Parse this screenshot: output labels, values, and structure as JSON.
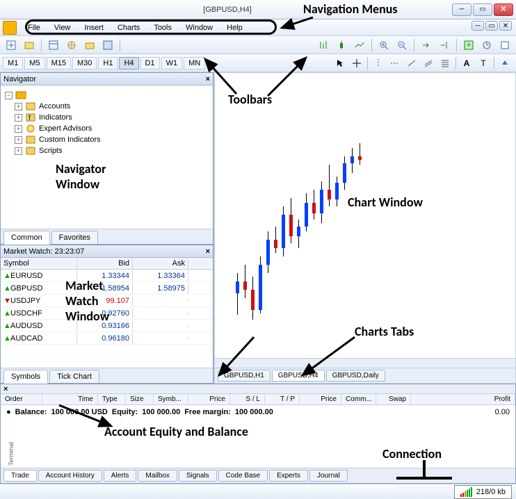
{
  "window": {
    "title": "[GBPUSD,H4]"
  },
  "menu": {
    "items": [
      "File",
      "View",
      "Insert",
      "Charts",
      "Tools",
      "Window",
      "Help"
    ]
  },
  "timeframes": {
    "items": [
      "M1",
      "M5",
      "M15",
      "M30",
      "H1",
      "H4",
      "D1",
      "W1",
      "MN"
    ],
    "active": "H4"
  },
  "navigator": {
    "title": "Navigator",
    "items": [
      "Accounts",
      "Indicators",
      "Expert Advisors",
      "Custom Indicators",
      "Scripts"
    ],
    "tabs": [
      "Common",
      "Favorites"
    ],
    "active_tab": "Common"
  },
  "market_watch": {
    "title": "Market Watch: 23:23:07",
    "columns": [
      "Symbol",
      "Bid",
      "Ask"
    ],
    "rows": [
      {
        "sym": "EURUSD",
        "dir": "up",
        "bid": "1.33344",
        "ask": "1.33364"
      },
      {
        "sym": "GBPUSD",
        "dir": "up",
        "bid": "1.58954",
        "ask": "1.58975"
      },
      {
        "sym": "USDJPY",
        "dir": "down",
        "bid": "99.107",
        "ask": "",
        "red": true
      },
      {
        "sym": "USDCHF",
        "dir": "up",
        "bid": "0.92760",
        "ask": ""
      },
      {
        "sym": "AUDUSD",
        "dir": "up",
        "bid": "0.93166",
        "ask": ""
      },
      {
        "sym": "AUDCAD",
        "dir": "up",
        "bid": "0.96180",
        "ask": ""
      }
    ],
    "tabs": [
      "Symbols",
      "Tick Chart"
    ],
    "active_tab": "Symbols"
  },
  "chart": {
    "tabs": [
      "GBPUSD,H1",
      "GBPUSD,H4",
      "GBPUSD,Daily"
    ],
    "active_tab": "GBPUSD,H4"
  },
  "terminal": {
    "columns": [
      "Order",
      "Time",
      "Type",
      "Size",
      "Symb...",
      "Price",
      "S / L",
      "T / P",
      "Price",
      "Comm...",
      "Swap",
      "Profit"
    ],
    "balance_label": "Balance:",
    "balance": "100 000.00 USD",
    "equity_label": "Equity:",
    "equity": "100 000.00",
    "freemargin_label": "Free margin:",
    "freemargin": "100 000.00",
    "profit": "0.00",
    "tabs": [
      "Trade",
      "Account History",
      "Alerts",
      "Mailbox",
      "Signals",
      "Code Base",
      "Experts",
      "Journal"
    ],
    "active_tab": "Trade",
    "side_label": "Terminal"
  },
  "status": {
    "connection": "218/0 kb"
  },
  "annotations": {
    "nav_menus": "Navigation Menus",
    "toolbars": "Toolbars",
    "navigator_window": "Navigator\nWindow",
    "chart_window": "Chart Window",
    "market_watch_window": "Market\nWatch\nWindow",
    "charts_tabs": "Charts Tabs",
    "account_equity": "Account Equity and Balance",
    "connection": "Connection"
  },
  "chart_data": {
    "type": "candlestick",
    "symbol": "GBPUSD",
    "timeframe": "H4",
    "title": "GBPUSD,H4",
    "candles": [
      {
        "x": 0,
        "o": 18,
        "h": 30,
        "l": 5,
        "c": 25
      },
      {
        "x": 1,
        "o": 25,
        "h": 35,
        "l": 15,
        "c": 20
      },
      {
        "x": 2,
        "o": 20,
        "h": 28,
        "l": 2,
        "c": 8
      },
      {
        "x": 3,
        "o": 8,
        "h": 40,
        "l": 6,
        "c": 35
      },
      {
        "x": 4,
        "o": 35,
        "h": 55,
        "l": 30,
        "c": 50
      },
      {
        "x": 5,
        "o": 50,
        "h": 58,
        "l": 42,
        "c": 45
      },
      {
        "x": 6,
        "o": 45,
        "h": 70,
        "l": 40,
        "c": 65
      },
      {
        "x": 7,
        "o": 65,
        "h": 75,
        "l": 48,
        "c": 52
      },
      {
        "x": 8,
        "o": 52,
        "h": 62,
        "l": 45,
        "c": 58
      },
      {
        "x": 9,
        "o": 58,
        "h": 78,
        "l": 55,
        "c": 72
      },
      {
        "x": 10,
        "o": 72,
        "h": 80,
        "l": 62,
        "c": 66
      },
      {
        "x": 11,
        "o": 66,
        "h": 85,
        "l": 60,
        "c": 80
      },
      {
        "x": 12,
        "o": 80,
        "h": 95,
        "l": 70,
        "c": 74
      },
      {
        "x": 13,
        "o": 74,
        "h": 88,
        "l": 70,
        "c": 84
      },
      {
        "x": 14,
        "o": 84,
        "h": 100,
        "l": 80,
        "c": 96
      },
      {
        "x": 15,
        "o": 96,
        "h": 105,
        "l": 90,
        "c": 100
      },
      {
        "x": 16,
        "o": 100,
        "h": 108,
        "l": 95,
        "c": 98
      }
    ],
    "ylim": [
      0,
      110
    ]
  }
}
